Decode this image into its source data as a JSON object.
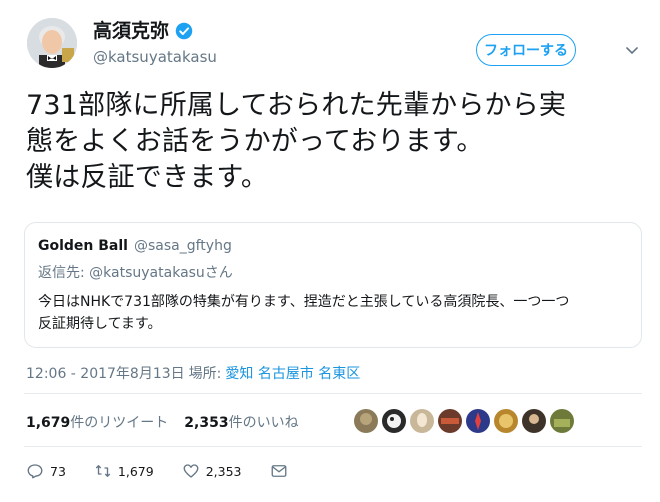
{
  "author": {
    "display_name": "高須克弥",
    "handle": "@katsuyatakasu",
    "verified": true
  },
  "follow_button": {
    "label": "フォローする"
  },
  "tweet": {
    "text": "731部隊に所属しておられた先輩からから実\n態をよくお話をうかがっております。\n僕は反証できます。"
  },
  "quoted_tweet": {
    "display_name": "Golden Ball",
    "handle": "@sasa_gftyhg",
    "reply_prefix": "返信先: ",
    "reply_to": "@katsuyatakasuさん",
    "text": "今日はNHKで731部隊の特集が有ります、捏造だと主張している高須院長、一つ一つ\n反証期待してます。"
  },
  "meta": {
    "timestamp": "12:06 - 2017年8月13日",
    "place_label": "場所:",
    "place": "愛知 名古屋市 名東区"
  },
  "stats": {
    "retweets_count": "1,679",
    "retweets_label": "件のリツイート",
    "likes_count": "2,353",
    "likes_label": "件のいいね"
  },
  "likers": [
    {
      "icon": "liker-avatar-1",
      "color": "#8a7a5a"
    },
    {
      "icon": "liker-avatar-2",
      "color": "#2a2a2a"
    },
    {
      "icon": "liker-avatar-3",
      "color": "#c9b79a"
    },
    {
      "icon": "liker-avatar-4",
      "color": "#6b3a2a"
    },
    {
      "icon": "liker-avatar-5",
      "color": "#2d3a8a"
    },
    {
      "icon": "liker-avatar-6",
      "color": "#b8872d"
    },
    {
      "icon": "liker-avatar-7",
      "color": "#3d3328"
    },
    {
      "icon": "liker-avatar-8",
      "color": "#6e7a3a"
    }
  ],
  "actions": {
    "replies": "73",
    "retweets": "1,679",
    "likes": "2,353"
  },
  "colors": {
    "accent": "#1da1f2",
    "secondary_text": "#657786",
    "border": "#e1e8ed"
  }
}
